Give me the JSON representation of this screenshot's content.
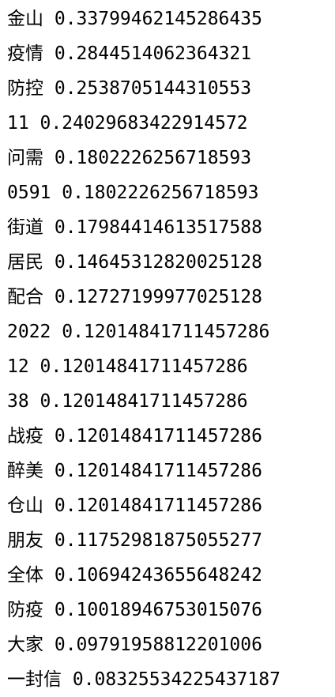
{
  "output_lines": [
    "金山 0.3379946214528643​5",
    "疫情 0.2844514062364321",
    "防控 0.2538705144310553",
    "11 0.24029683422914572",
    "问需 0.1802226256718593",
    "0591 0.1802226256718593",
    "街道 0.17984414613517588",
    "居民 0.14645312820025128",
    "配合 0.12727199977025128",
    "2022 0.12014841711457286",
    "12 0.12014841711457286",
    "38 0.12014841711457286",
    "战疫 0.12014841711457286",
    "醉美 0.12014841711457286",
    "仓山 0.12014841711457286",
    "朋友 0.11752981875055277",
    "全体 0.10694243655648242",
    "防疫 0.10018946753015076",
    "大家 0.09791958812201006",
    "一封信 0.08325534225437187"
  ]
}
